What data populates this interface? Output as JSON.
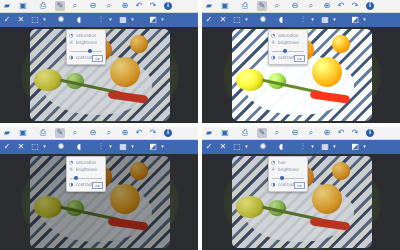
{
  "panes": [
    {
      "filter": {
        "label_top": "saturation",
        "value": "",
        "label_mid": "brightness",
        "label_bottom": "contrast",
        "apply": "OK",
        "knob_fraction": 0.62
      }
    },
    {
      "filter": {
        "label_top": "saturation",
        "value": "",
        "label_mid": "brightness",
        "label_bottom": "contrast",
        "apply": "OK",
        "knob_fraction": 0.42
      }
    },
    {
      "filter": {
        "label_top": "saturation",
        "value": "",
        "label_mid": "brightness",
        "label_bottom": "contrast",
        "apply": "OK",
        "knob_fraction": 0.2
      }
    },
    {
      "filter": {
        "label_top": "hue",
        "value": "",
        "label_mid": "brightness",
        "label_bottom": "contrast",
        "apply": "OK",
        "knob_fraction": 0.3
      }
    }
  ],
  "toolbar_icons": [
    "folder-icon",
    "save-icon",
    "print-icon",
    "adjust-icon",
    "zoom-in-icon",
    "zoom-out-icon",
    "zoom-fit-icon",
    "rotate-left-icon",
    "rotate-right-icon",
    "info-icon"
  ],
  "action_icons": [
    "check-icon",
    "close-icon",
    "select-icon",
    "brightness-icon",
    "color-drop-icon",
    "levels-icon",
    "crop-icon",
    "eraser-icon"
  ],
  "colors": {
    "toolbar_bg": "#f3f3f4",
    "action_bar": "#3f68b3",
    "accent": "#2b6cb7"
  }
}
